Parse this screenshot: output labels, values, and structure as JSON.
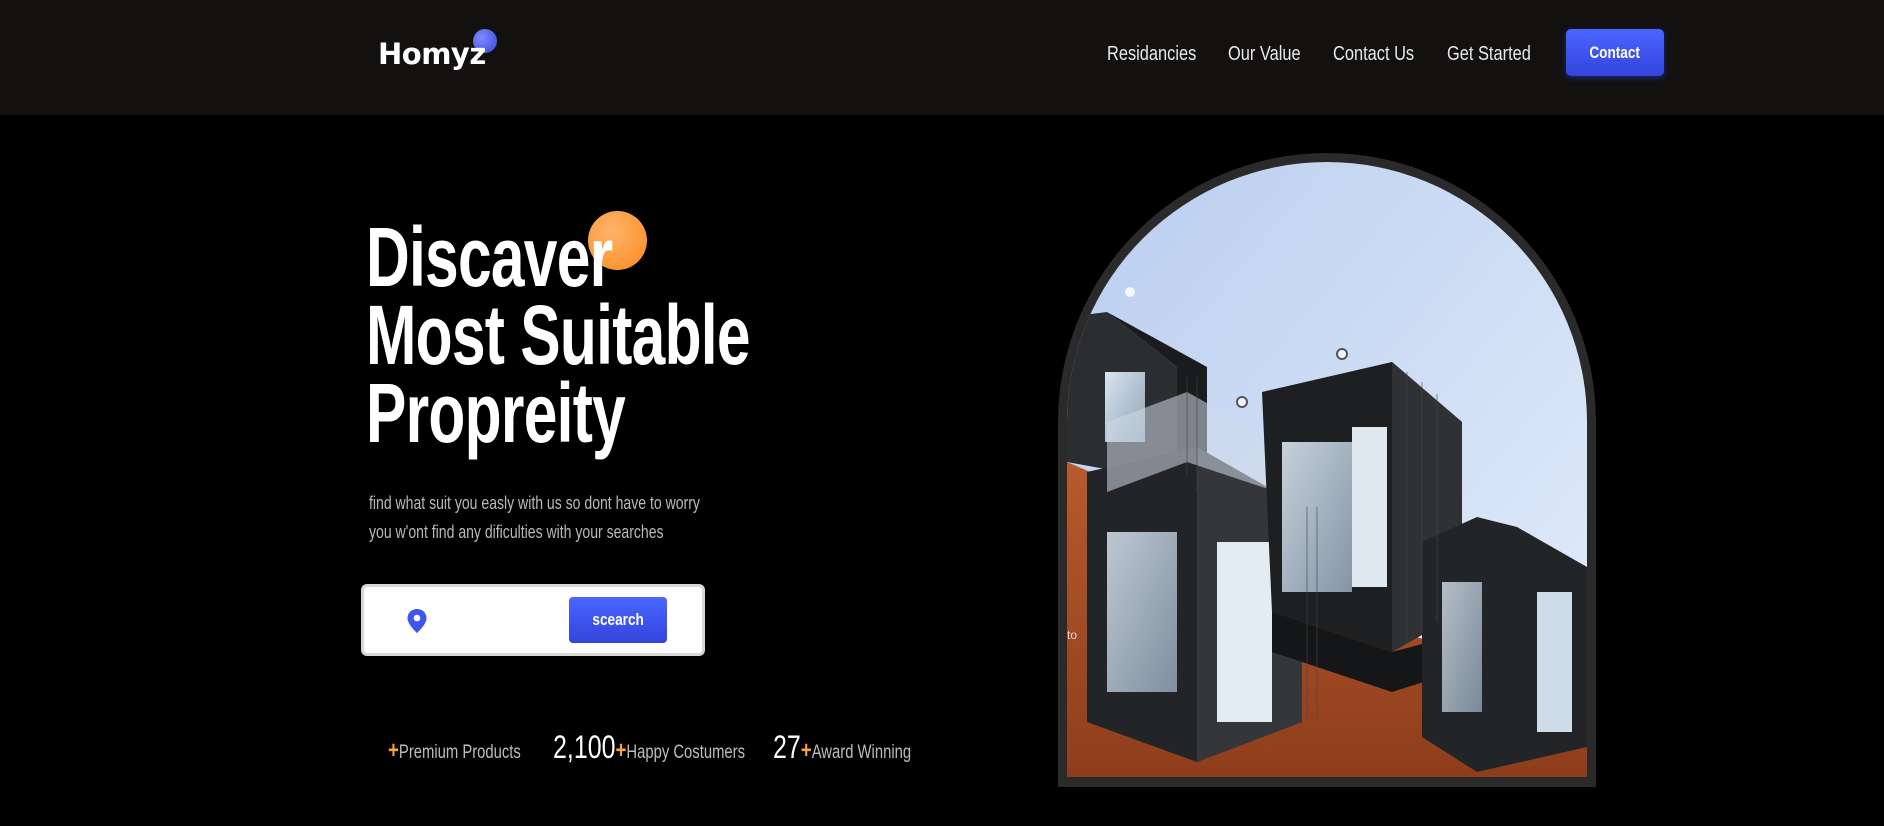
{
  "header": {
    "logo_text": "Homyz",
    "nav": [
      {
        "label": "Residancies"
      },
      {
        "label": "Our Value"
      },
      {
        "label": "Contact Us"
      },
      {
        "label": "Get Started"
      }
    ],
    "contact_label": "Contact"
  },
  "hero": {
    "title_lines": [
      "Discaver",
      "Most Suitable",
      "Propreity"
    ],
    "subtitle_lines": [
      "find what suit you easly with us so dont have to worry",
      "you w'ont find any dificulties with your searches"
    ],
    "search": {
      "placeholder": "",
      "button_label": "scearch",
      "icon": "location-pin-icon"
    },
    "stats": [
      {
        "number": "",
        "plus": "+",
        "label": "Premium Products"
      },
      {
        "number": "2,100",
        "plus": "+",
        "label": "Happy Costumers"
      },
      {
        "number": "27",
        "plus": "+",
        "label": "Award Winning"
      }
    ],
    "image_alt_text": "to"
  },
  "colors": {
    "accent_blue": "#3f57f0",
    "accent_orange": "#f8a33c",
    "header_bg": "#131110",
    "page_bg": "#000000"
  }
}
